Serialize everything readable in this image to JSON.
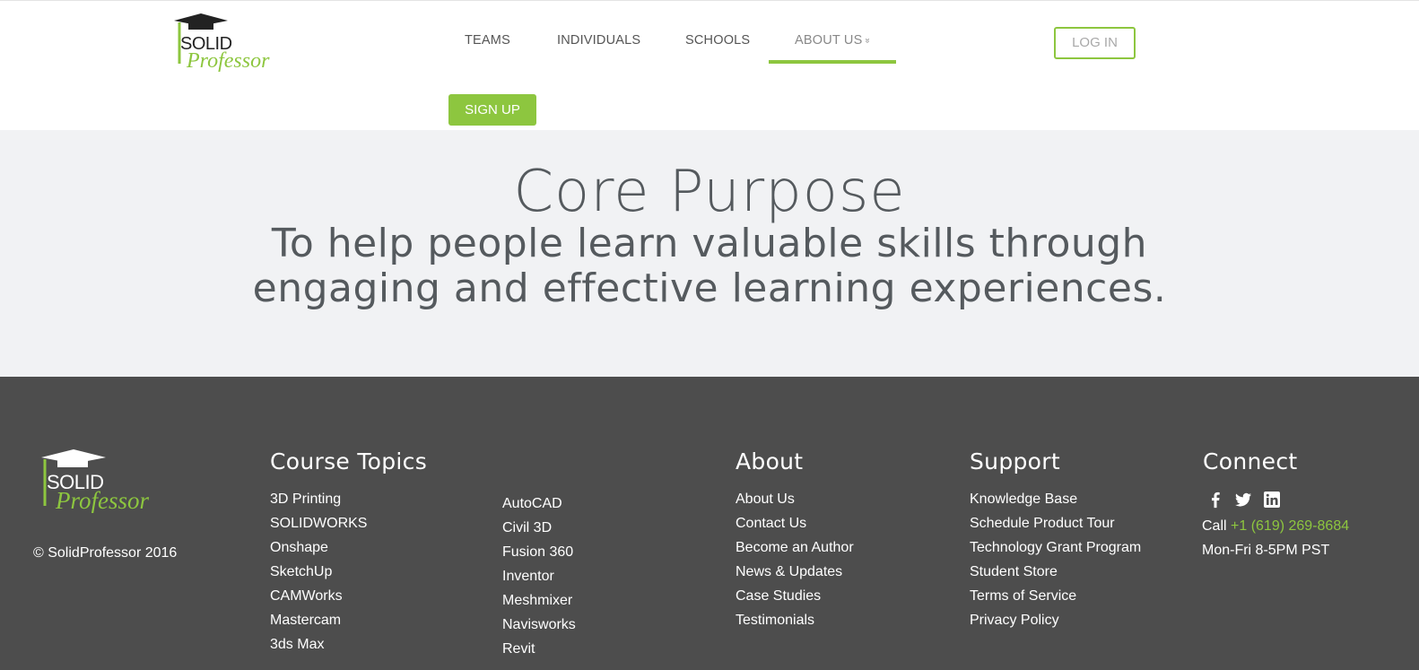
{
  "brand": {
    "logo_top": "SOLID",
    "logo_bottom": "Professor",
    "accent": "#8dc63f"
  },
  "nav": {
    "items": [
      {
        "label": "TEAMS"
      },
      {
        "label": "INDIVIDUALS"
      },
      {
        "label": "SCHOOLS"
      },
      {
        "label": "ABOUT US"
      }
    ],
    "about_chevron": "»",
    "login": "LOG IN",
    "signup": "SIGN UP"
  },
  "hero": {
    "title": "Core Purpose",
    "subtitle": "To help people learn valuable skills through engaging and effective learning experiences."
  },
  "footer": {
    "copyright": "© SolidProfessor 2016",
    "course_topics": {
      "title": "Course Topics",
      "col1": [
        "3D Printing",
        "SOLIDWORKS",
        "Onshape",
        "SketchUp",
        "CAMWorks",
        "Mastercam",
        "3ds Max"
      ],
      "col2": [
        "AutoCAD",
        "Civil 3D",
        "Fusion 360",
        "Inventor",
        "Meshmixer",
        "Navisworks",
        "Revit"
      ]
    },
    "about": {
      "title": "About",
      "items": [
        "About Us",
        "Contact Us",
        "Become an Author",
        "News & Updates",
        "Case Studies",
        "Testimonials"
      ]
    },
    "support": {
      "title": "Support",
      "items": [
        "Knowledge Base",
        "Schedule Product Tour",
        "Technology Grant Program",
        "Student Store",
        "Terms of Service",
        "Privacy Policy"
      ]
    },
    "connect": {
      "title": "Connect",
      "icons": [
        "facebook-icon",
        "twitter-icon",
        "linkedin-icon"
      ],
      "call_label": "Call",
      "phone": "+1 (619) 269-8684",
      "hours": "Mon-Fri 8-5PM PST"
    }
  }
}
